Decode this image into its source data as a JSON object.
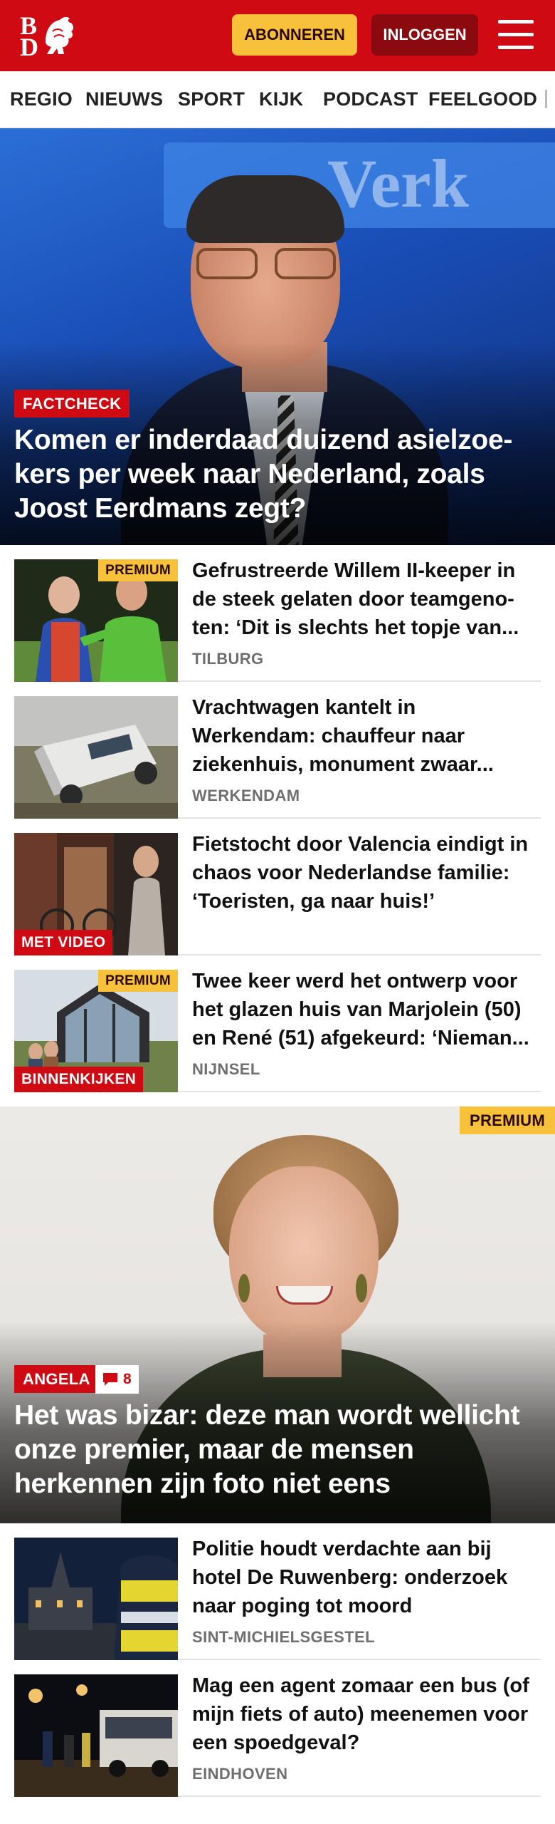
{
  "header": {
    "logo": {
      "line1": "B",
      "line2": "D"
    },
    "subscribe_label": "ABONNEREN",
    "login_label": "INLOGGEN",
    "colors": {
      "brand": "#cf0a12",
      "subscribe": "#f7c23a",
      "login": "#8a0a10"
    }
  },
  "nav": {
    "items": [
      "REGIO",
      "NIEUWS",
      "SPORT",
      "KIJK",
      "PODCAST",
      "FEELGOOD"
    ]
  },
  "hero1": {
    "label": "FACTCHECK",
    "title": "Komen er inderdaad duizend asielzoe­kers per week naar Nederland, zoals Joost Eerdmans zegt?",
    "sign_text": "Verk"
  },
  "articles": [
    {
      "badge": "PREMIUM",
      "title": "Gefrustreerde Willem II-keeper in de steek gelaten door teamgeno­ten: ‘Dit is slechts het topje van...",
      "location": "TILBURG"
    },
    {
      "title": "Vrachtwagen kantelt in Werkendam: chauffeur naar ziekenhuis, monument zwaar...",
      "location": "WERKENDAM"
    },
    {
      "label": "MET VIDEO",
      "title": "Fietstocht door Valencia eindigt in chaos voor Nederlandse familie: ‘Toeristen, ga naar huis!’"
    },
    {
      "badge": "PREMIUM",
      "label": "BINNENKIJKEN",
      "title": "Twee keer werd het ontwerp voor het glazen huis van Marjolein (50) en René (51) afgekeurd: ‘Nieman...",
      "location": "NIJNSEL"
    }
  ],
  "hero2": {
    "badge": "PREMIUM",
    "label": "ANGELA",
    "comment_count": "8",
    "title": "Het was bizar: deze man wordt wellicht onze premier, maar de mensen herkennen zijn foto niet eens"
  },
  "articles2": [
    {
      "title": "Politie houdt verdachte aan bij hotel De Ruwenberg: onderzoek naar poging tot moord",
      "location": "SINT-MICHIELSGESTEL"
    },
    {
      "title": "Mag een agent zomaar een bus (of mijn fiets of auto) meenemen voor een spoedgeval?",
      "location": "EINDHOVEN"
    }
  ]
}
